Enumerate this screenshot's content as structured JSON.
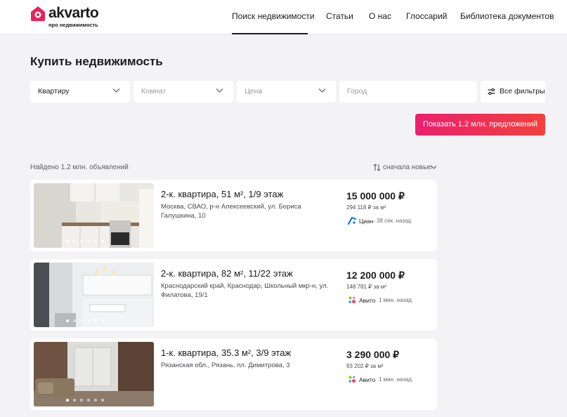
{
  "header": {
    "logo_name": "akvarto",
    "logo_sub": "про недвижимость",
    "brand_color": "#e8245a",
    "nav": [
      {
        "label": "Поиск недвижимости",
        "active": true
      },
      {
        "label": "Статьи",
        "active": false
      },
      {
        "label": "О нас",
        "active": false
      },
      {
        "label": "Глоссарий",
        "active": false
      },
      {
        "label": "Библиотека документов",
        "active": false
      }
    ]
  },
  "page": {
    "title": "Купить недвижимость"
  },
  "filters": {
    "type_value": "Квартиру",
    "rooms_placeholder": "Комнат",
    "price_placeholder": "Цена",
    "city_placeholder": "Город",
    "all_filters_label": "Все фильтры",
    "show_button_label": "Показать 1.2 млн. предложений"
  },
  "results": {
    "found_text": "Найдено 1.2 млн. объявлений",
    "sort_label": "сначала новые"
  },
  "listings": [
    {
      "title": "2-к. квартира, 51 м², 1/9 этаж",
      "address": "Москва, СВАО, р-н Алексеевский, ул. Бориса Галушкина, 10",
      "price": "15 000 000 ₽",
      "price_per_m2": "294 118 ₽ за м²",
      "source": "Циан",
      "source_icon": "cian-icon",
      "time": "38 сек. назад",
      "photo_index": 1,
      "photo_count": 6
    },
    {
      "title": "2-к. квартира, 82 м², 11/22 этаж",
      "address": "Краснодарский край, Краснодар, Школьный мкр-н, ул. Филатова, 19/1",
      "price": "12 200 000 ₽",
      "price_per_m2": "148 781 ₽ за м²",
      "source": "Авито",
      "source_icon": "avito-icon",
      "time": "1 мин. назад",
      "photo_index": 1,
      "photo_count": 6
    },
    {
      "title": "1-к. квартира, 35.3 м², 3/9 этаж",
      "address": "Рязанская обл., Рязань, пл. Димитрова, 3",
      "price": "3 290 000 ₽",
      "price_per_m2": "93 202 ₽ за м²",
      "source": "Авито",
      "source_icon": "avito-icon",
      "time": "1 мин. назад",
      "photo_index": 1,
      "photo_count": 6
    }
  ]
}
